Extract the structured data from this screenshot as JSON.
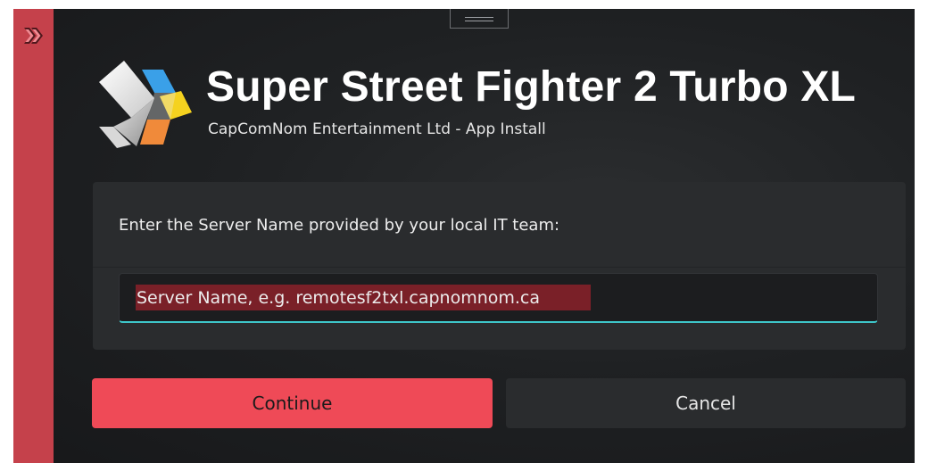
{
  "window": {
    "app_title": "Super Street Fighter 2 Turbo XL",
    "app_subtitle": "CapComNom Entertainment Ltd - App Install"
  },
  "sidebar": {
    "icon": "chevrons-right-icon"
  },
  "panel": {
    "prompt": "Enter the Server Name provided by your local IT team:",
    "server_input": {
      "value": "",
      "placeholder": "Server Name, e.g. remotesf2txl.capnomnom.ca"
    }
  },
  "buttons": {
    "continue_label": "Continue",
    "cancel_label": "Cancel"
  },
  "colors": {
    "sidebar": "#c5414b",
    "accent_button": "#ef4a57",
    "input_focus_underline": "#3ec6c9",
    "background": "#1f2123"
  }
}
